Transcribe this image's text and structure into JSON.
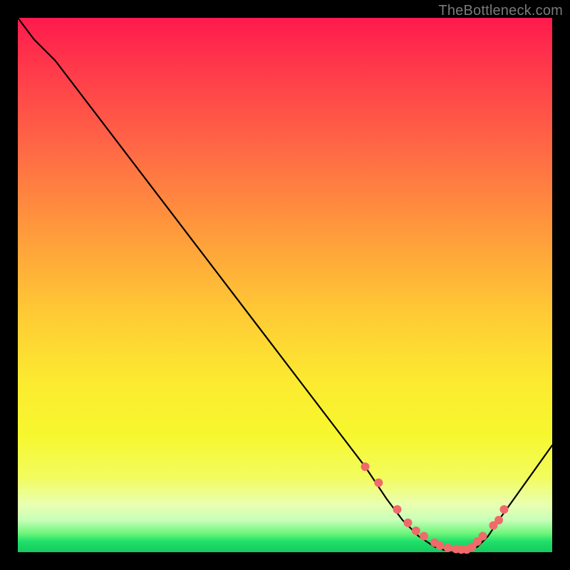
{
  "watermark": "TheBottleneck.com",
  "chart_data": {
    "type": "line",
    "title": "",
    "xlabel": "",
    "ylabel": "",
    "xlim": [
      0,
      100
    ],
    "ylim": [
      0,
      100
    ],
    "series": [
      {
        "name": "bottleneck-curve",
        "x": [
          0,
          3,
          7,
          65,
          69,
          72,
          75,
          78,
          81,
          84,
          86,
          88,
          90,
          100
        ],
        "values": [
          100,
          96,
          92,
          16,
          10,
          6,
          3,
          1,
          0,
          0,
          1,
          3,
          6,
          20
        ]
      }
    ],
    "markers": {
      "name": "data-points",
      "color": "#f06a6a",
      "x": [
        65,
        67.5,
        71,
        73,
        74.5,
        76,
        78,
        79,
        80.5,
        82,
        83,
        84,
        85,
        86,
        87,
        89,
        90,
        91
      ],
      "values": [
        16,
        13,
        8,
        5.5,
        4,
        3,
        1.8,
        1.2,
        0.8,
        0.6,
        0.5,
        0.5,
        1,
        2,
        3,
        5,
        6,
        8
      ]
    }
  }
}
